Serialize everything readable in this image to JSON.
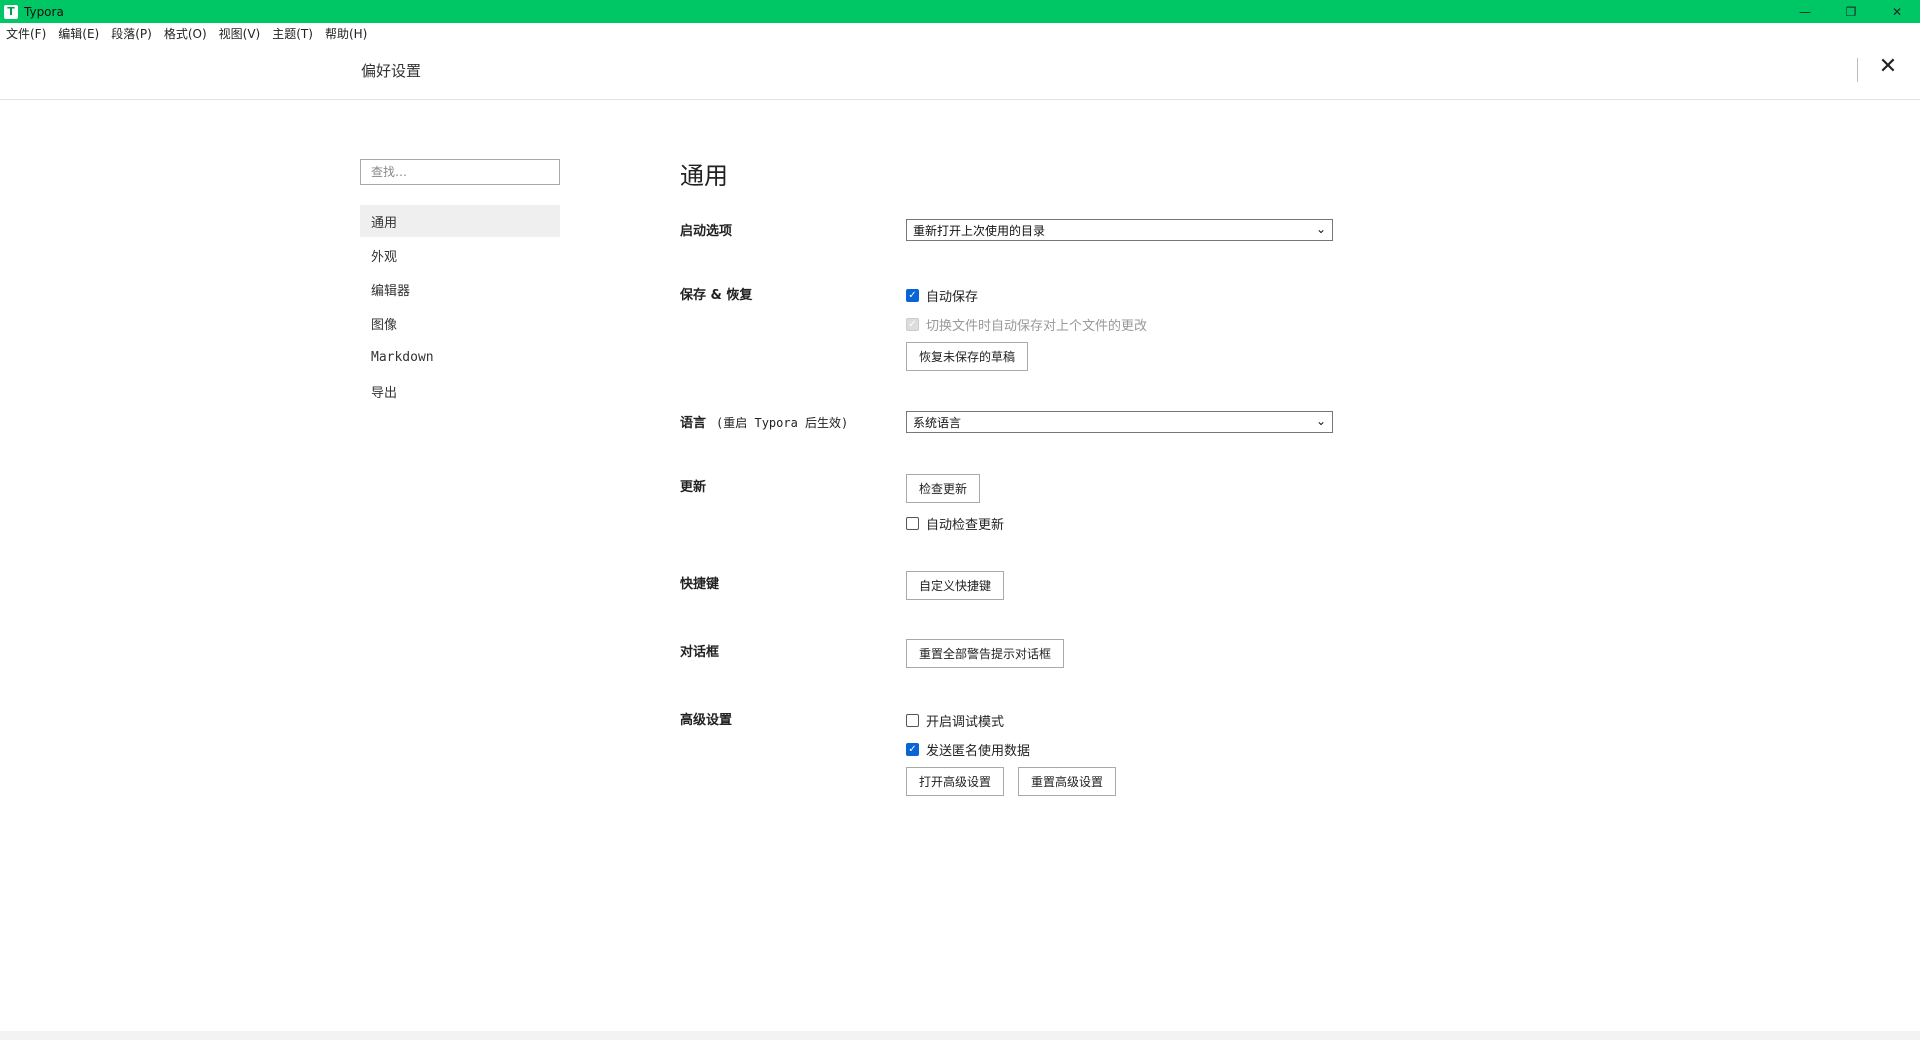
{
  "titlebar": {
    "app_icon": "T",
    "title": "Typora",
    "minimize": "—",
    "restore": "❐",
    "close": "✕"
  },
  "menu": [
    "文件(F)",
    "编辑(E)",
    "段落(P)",
    "格式(O)",
    "视图(V)",
    "主题(T)",
    "帮助(H)"
  ],
  "header": {
    "title": "偏好设置",
    "close_icon": "✕"
  },
  "sidebar": {
    "search_placeholder": "查找…",
    "items": [
      {
        "label": "通用",
        "active": true
      },
      {
        "label": "外观"
      },
      {
        "label": "编辑器"
      },
      {
        "label": "图像"
      },
      {
        "label": "Markdown"
      },
      {
        "label": "导出"
      }
    ]
  },
  "content": {
    "title": "通用",
    "startup": {
      "label": "启动选项",
      "value": "重新打开上次使用的目录"
    },
    "save": {
      "label": "保存 & 恢复",
      "autosave": {
        "label": "自动保存",
        "checked": true
      },
      "switch_save": {
        "label": "切换文件时自动保存对上个文件的更改",
        "checked": false,
        "disabled": true
      },
      "recover_button": "恢复未保存的草稿"
    },
    "language": {
      "label": "语言",
      "note": "(重启 Typora 后生效)",
      "value": "系统语言"
    },
    "update": {
      "label": "更新",
      "check_button": "检查更新",
      "auto_check": {
        "label": "自动检查更新",
        "checked": false
      }
    },
    "shortcuts": {
      "label": "快捷键",
      "button": "自定义快捷键"
    },
    "dialog": {
      "label": "对话框",
      "button": "重置全部警告提示对话框"
    },
    "advanced": {
      "label": "高级设置",
      "debug": {
        "label": "开启调试模式",
        "checked": false
      },
      "telemetry": {
        "label": "发送匿名使用数据",
        "checked": true
      },
      "open_button": "打开高级设置",
      "reset_button": "重置高级设置"
    }
  }
}
